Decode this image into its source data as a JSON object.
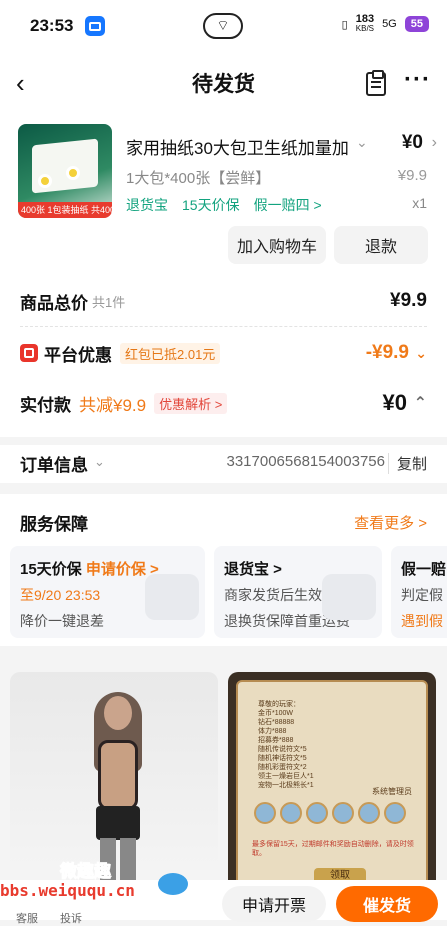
{
  "status_bar": {
    "time": "23:53",
    "speed": "183",
    "speed_unit": "KB/S",
    "network": "5G",
    "battery": "55"
  },
  "nav": {
    "title": "待发货"
  },
  "product": {
    "thumb_tag": "400张 1包装抽纸 共400张",
    "name": "家用抽纸30大包卫生纸加量加",
    "price": "¥0",
    "spec": "1大包*400张【尝鲜】",
    "original_price": "¥9.9",
    "guarantee": "退货宝　15天价保　假一赔四 >",
    "quantity": "x1",
    "add_cart_label": "加入购物车",
    "refund_label": "退款"
  },
  "pricing": {
    "total_label": "商品总价",
    "total_count": "共1件",
    "total_value": "¥9.9",
    "discount_label": "平台优惠",
    "discount_tag": "红包已抵2.01元",
    "discount_value": "-¥9.9",
    "paid_label": "实付款",
    "paid_saved": "共减¥9.9",
    "paid_detail": "优惠解析 >",
    "paid_value": "¥0"
  },
  "order": {
    "label": "订单信息",
    "number": "3317006568154003756",
    "copy_label": "复制"
  },
  "service": {
    "title": "服务保障",
    "more": "查看更多 >",
    "cards": [
      {
        "title": "15天价保",
        "action": "申请价保 >",
        "line1": "至9/20 23:53",
        "line2": "降价一键退差"
      },
      {
        "title": "退货宝 >",
        "line1": "商家发货后生效",
        "line2": "退换货保障首重运费"
      },
      {
        "title": "假一赔",
        "line1": "判定假",
        "line2": "遇到假"
      }
    ]
  },
  "feed": {
    "game_text": "尊敬的玩家：\n金币*100W\n钻石*88888\n体力*888\n招募券*888\n随机传说符文*5\n随机神话符文*5\n随机彩蛋符文*2\n领主一燥岩巨人*1\n宠物一北极熊长*1",
    "game_sender": "系统管理员",
    "game_note": "最多保留15天，过期邮件和奖励自动删除，请及时领取。",
    "game_button": "领取"
  },
  "watermark": {
    "cn": "微趣趣",
    "url": "bbs.weiququ.cn"
  },
  "bottom_bar": {
    "service_label": "客服",
    "complain_label": "投诉",
    "invoice_label": "申请开票",
    "urge_label": "催发货"
  }
}
